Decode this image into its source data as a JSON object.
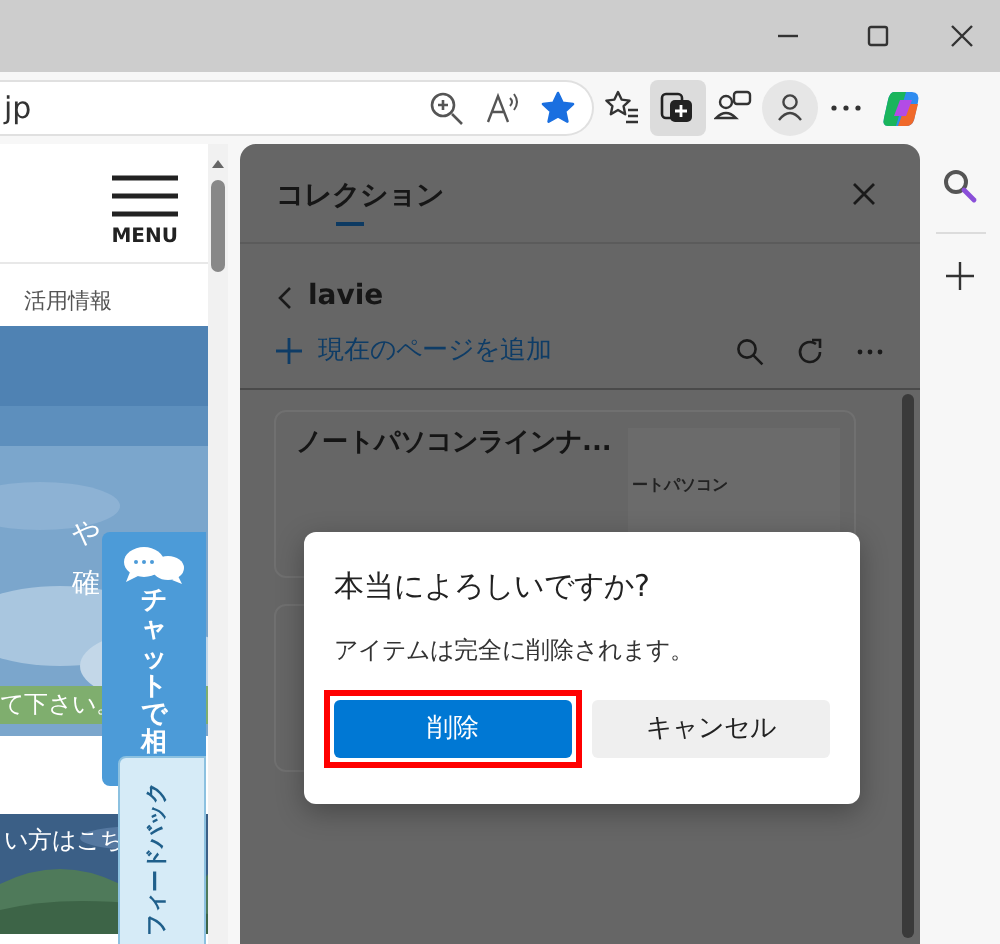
{
  "address_bar": {
    "url": "jp",
    "favorite": true
  },
  "toolbar_buttons": [
    {
      "kind": "favorites",
      "selected": false
    },
    {
      "kind": "collections",
      "selected": true
    },
    {
      "kind": "workspaces",
      "selected": false
    },
    {
      "kind": "profile",
      "selected": false
    },
    {
      "kind": "more",
      "selected": false
    },
    {
      "kind": "copilot",
      "selected": false
    }
  ],
  "webpage": {
    "menu_label": "MENU",
    "nav_link": "活用情報",
    "hero_lines": [
      "や",
      "確"
    ],
    "notice": "て下さい。",
    "banner": "い方はこち",
    "chat_button": "チャットで相",
    "feedback_tab": "フィードバック"
  },
  "collections_panel": {
    "title": "コレクション",
    "collection_name": "lavie",
    "add_page": "現在のページを追加",
    "items": [
      {
        "kind": "page",
        "title": "ノートパソコンラインナ...",
        "thumbnail_text": "ートパソコン"
      },
      {
        "kind": "page"
      }
    ]
  },
  "dialog": {
    "title": "本当によろしいですか?",
    "message": "アイテムは完全に削除されます。",
    "buttons": [
      {
        "label": "削除",
        "kind": "primary",
        "highlighted": true
      },
      {
        "label": "キャンセル",
        "kind": "secondary",
        "highlighted": false
      }
    ]
  }
}
